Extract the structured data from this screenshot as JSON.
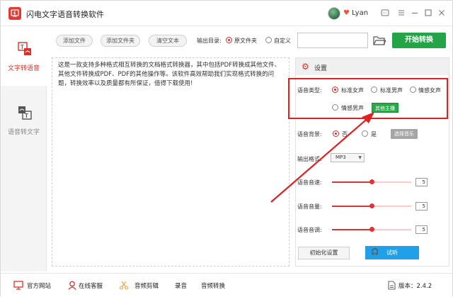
{
  "app": {
    "title": "闪电文字语音转换软件"
  },
  "user": {
    "name": "Lyan"
  },
  "sidebar": {
    "items": [
      {
        "label": "文字转语音",
        "active": true
      },
      {
        "label": "语音转文字",
        "active": false
      }
    ]
  },
  "toolbar": {
    "add_file": "添加文件",
    "add_folder": "添加文件夹",
    "clear_text": "清空文本",
    "output_label": "输出目录:",
    "output_options": [
      "原文件夹",
      "自定义"
    ],
    "output_selected": "原文件夹",
    "path_value": "",
    "start_button": "开始转换"
  },
  "content": {
    "text": "这是一款支持多种格式相互转换的文档格式转换器，其中包括PDF转换成其他文件、其他文件转换成PDF、PDF的其他操作等。该软件高效帮助我们实现格式转换的问题，转换效率以及质量都有所保证，值得下载使用!"
  },
  "settings": {
    "title": "设置",
    "voice_type_label": "语音类型:",
    "voice_options": [
      "标准女声",
      "标准男声",
      "情感女声",
      "情感男声"
    ],
    "voice_selected": "标准女声",
    "other_anchor": "其他主播",
    "bg_label": "语音背景:",
    "bg_options": [
      "否",
      "是"
    ],
    "bg_selected": "否",
    "choose_music": "选择音乐",
    "format_label": "输出格式:",
    "format_value": "MP3",
    "sliders": [
      {
        "label": "语音音速:",
        "value": "5",
        "level": 0.5
      },
      {
        "label": "语音音量:",
        "value": "5",
        "level": 0.5
      },
      {
        "label": "语音音调:",
        "value": "5",
        "level": 0.5
      }
    ],
    "reset_button": "初始化设置",
    "listen_button": "试听"
  },
  "footer": {
    "items": [
      "官方网站",
      "在线客服",
      "音频剪辑",
      "录音",
      "音频转换"
    ],
    "version": "版本：2.4.2"
  },
  "colors": {
    "accent_red": "#d62b2b",
    "start_green": "#22a447",
    "listen_blue": "#1fa0e8"
  }
}
